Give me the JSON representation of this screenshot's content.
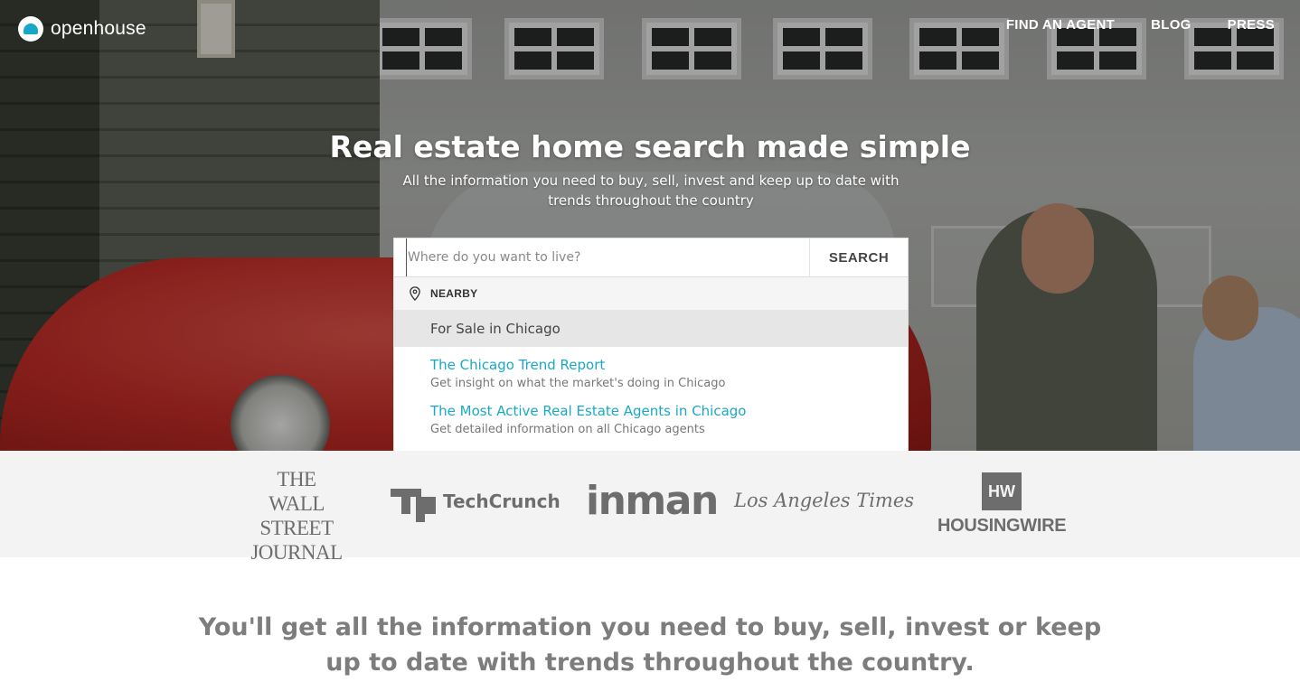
{
  "brand": {
    "name": "openhouse",
    "accent": "#1aa9c4"
  },
  "nav": {
    "items": [
      "FIND AN AGENT",
      "BLOG",
      "PRESS"
    ]
  },
  "hero": {
    "title": "Real estate home search made simple",
    "subtitle": "All the information you need to buy, sell, invest and keep up to date with trends throughout the country"
  },
  "search": {
    "placeholder": "Where do you want to live?",
    "value": "",
    "button_label": "SEARCH"
  },
  "dropdown": {
    "nearby_label": "NEARBY",
    "for_sale": "For Sale in Chicago",
    "suggestions": [
      {
        "title": "The Chicago Trend Report",
        "desc": "Get insight on what the market's doing in Chicago"
      },
      {
        "title": "The Most Active Real Estate Agents in Chicago",
        "desc": "Get detailed information on all Chicago agents"
      }
    ]
  },
  "press": {
    "wsj": [
      "THE",
      "WALL STREET",
      "JOURNAL"
    ],
    "techcrunch": "TechCrunch",
    "inman": "inman",
    "latimes": "Los Angeles Times",
    "housingwire_mark": "HW",
    "housingwire": "HOUSINGWIRE"
  },
  "tagline": "You'll get all the information you need to buy, sell, invest or keep up to date with trends throughout the country."
}
